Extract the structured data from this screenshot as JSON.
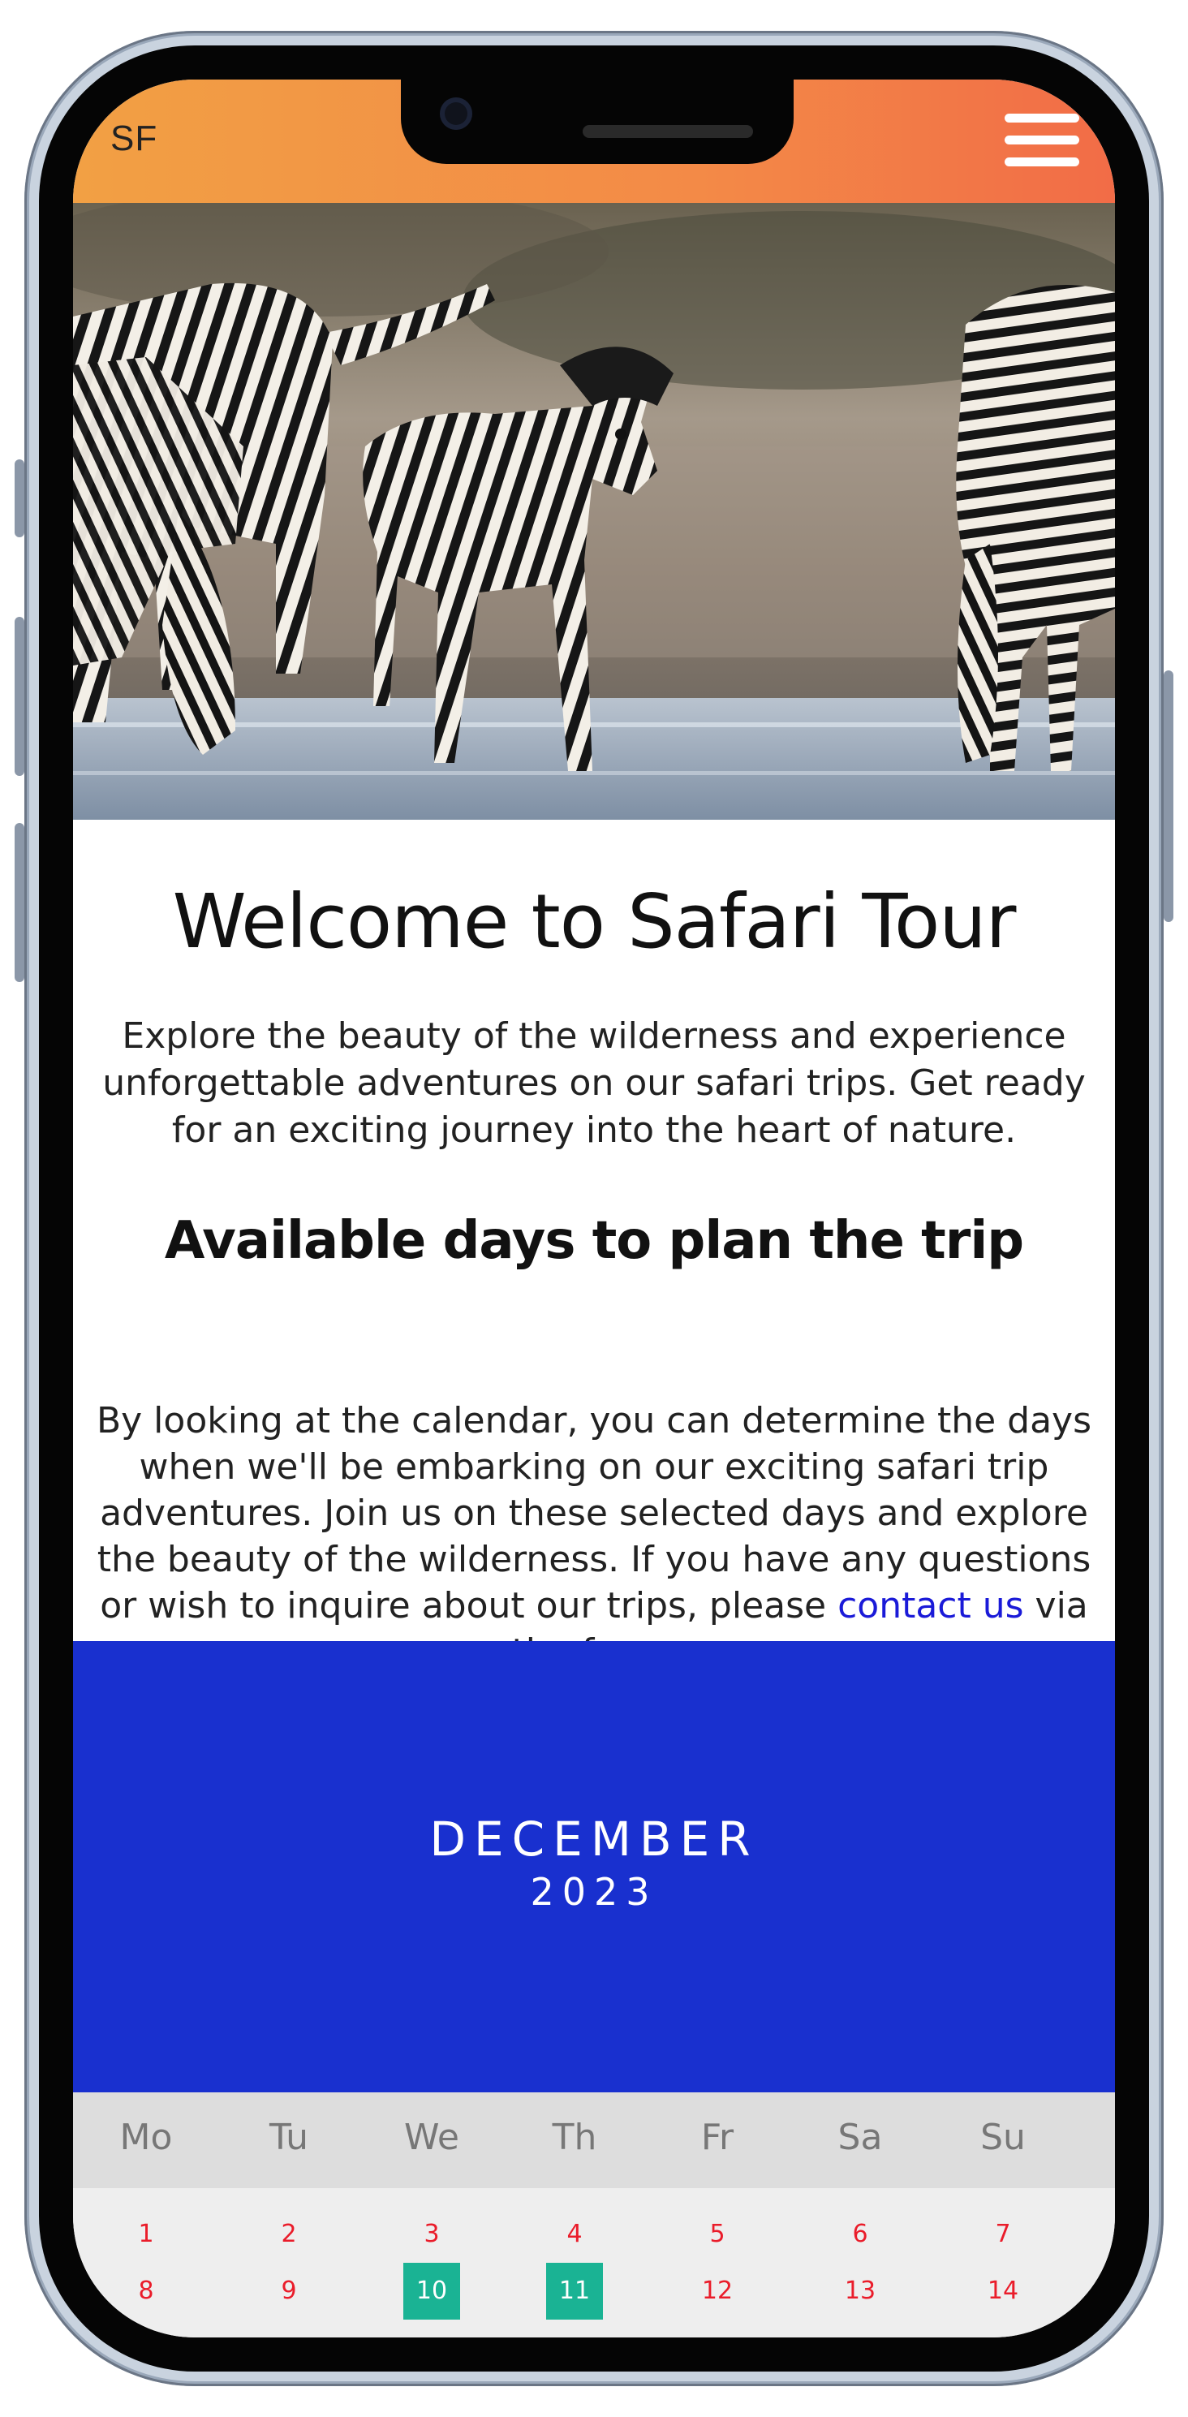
{
  "header": {
    "logo": "SF",
    "menu_icon": "hamburger-menu-icon",
    "gradient_colors": [
      "#f2a044",
      "#f26c47"
    ]
  },
  "hero": {
    "image": "zebras-drinking-at-waterhole"
  },
  "main": {
    "title": "Welcome to Safari Tour",
    "intro": "Explore the beauty of the wilderness and experience unforgettable adventures on our safari trips. Get ready for an exciting journey into the heart of nature.",
    "subtitle": "Available days to plan the trip",
    "body_before_link": "By looking at the calendar, you can determine the days when we'll be embarking on our exciting safari trip adventures. Join us on these selected days and explore the beauty of the wilderness. If you have any questions or wish to inquire about our trips, please ",
    "link_text": "contact us",
    "body_after_link": " via the form.",
    "link_color": "#1a1ad8"
  },
  "calendar": {
    "month": "DECEMBER",
    "year": "2023",
    "header_color": "#1930cf",
    "weekdays": [
      "Mo",
      "Tu",
      "We",
      "Th",
      "Fr",
      "Sa",
      "Su"
    ],
    "week1": [
      "1",
      "2",
      "3",
      "4",
      "5",
      "6",
      "7"
    ],
    "week2": [
      "8",
      "9",
      "10",
      "11",
      "12",
      "13",
      "14"
    ],
    "highlighted_days": [
      "10",
      "11"
    ],
    "highlight_color": "#1ab394",
    "day_color": "#ea1c2a"
  }
}
